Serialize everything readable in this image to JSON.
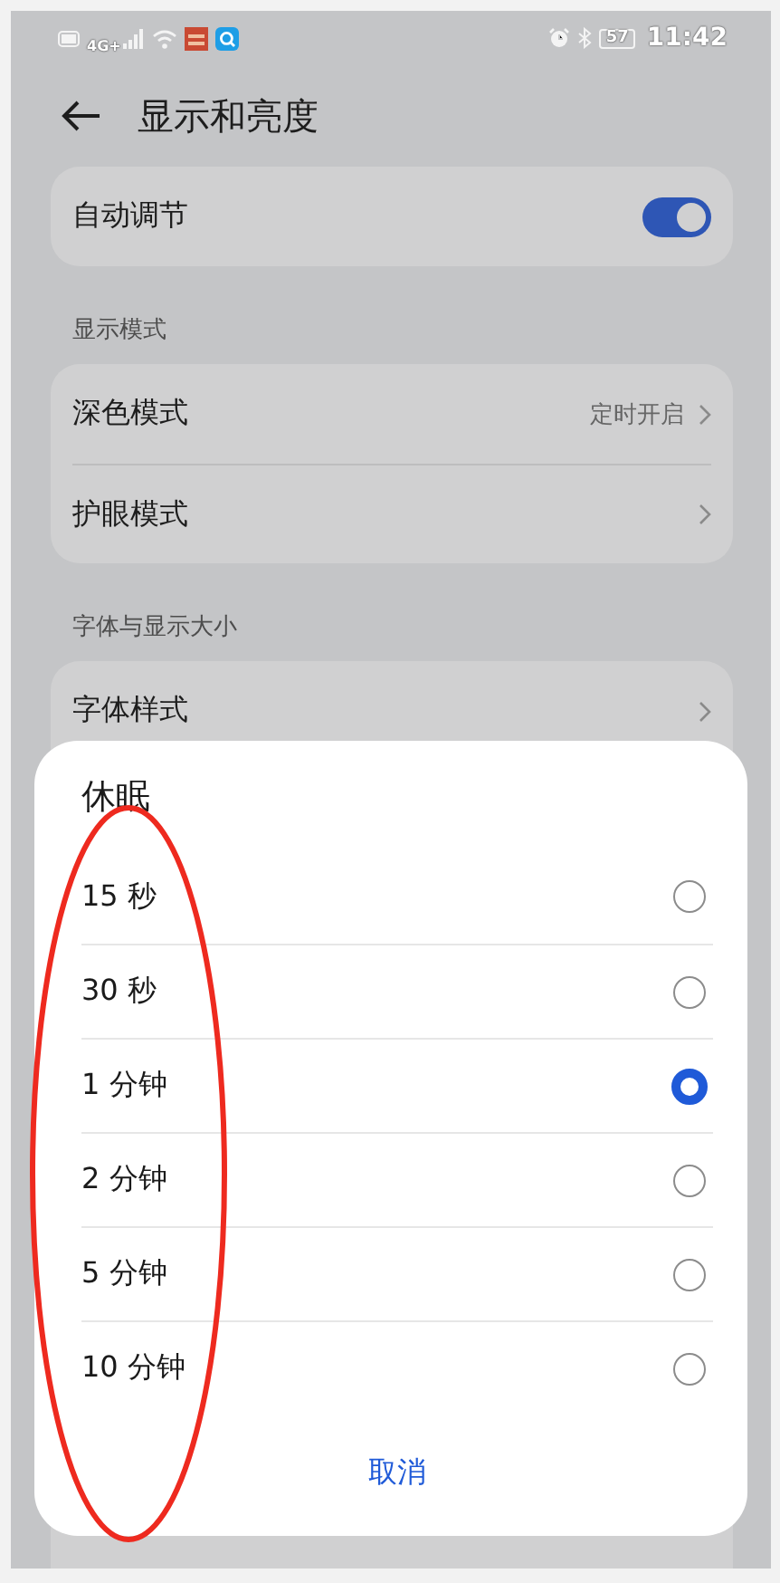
{
  "status_bar": {
    "network": "4G+",
    "battery": "57",
    "time": "11:42"
  },
  "header": {
    "title": "显示和亮度"
  },
  "auto_adjust": {
    "label": "自动调节",
    "on": true
  },
  "sections": [
    {
      "title": "显示模式",
      "items": [
        {
          "label": "深色模式",
          "value": "定时开启"
        },
        {
          "label": "护眼模式"
        }
      ]
    },
    {
      "title": "字体与显示大小",
      "items": [
        {
          "label": "字体样式"
        }
      ]
    }
  ],
  "dialog": {
    "title": "休眠",
    "options": [
      {
        "label": "15 秒",
        "selected": false
      },
      {
        "label": "30 秒",
        "selected": false
      },
      {
        "label": "1 分钟",
        "selected": true
      },
      {
        "label": "2 分钟",
        "selected": false
      },
      {
        "label": "5 分钟",
        "selected": false
      },
      {
        "label": "10 分钟",
        "selected": false
      }
    ],
    "cancel": "取消"
  }
}
